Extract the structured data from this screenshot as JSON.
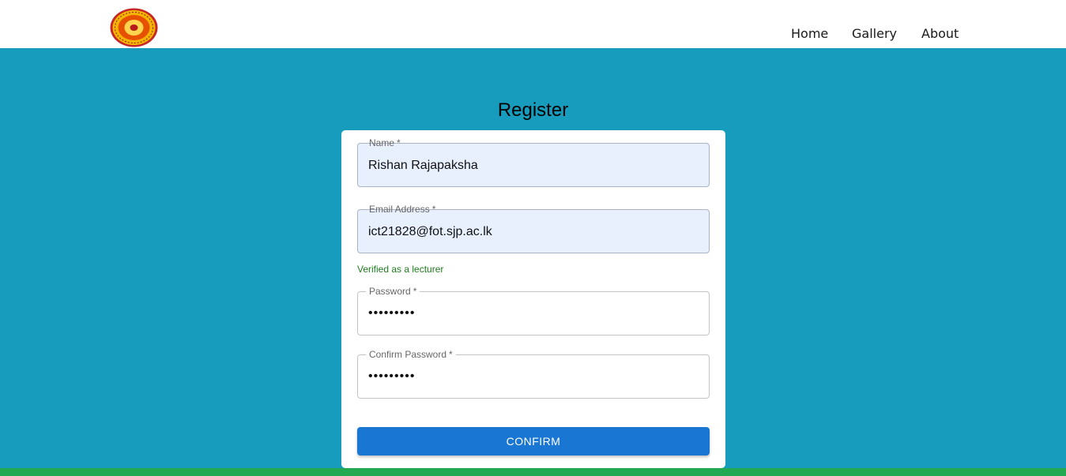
{
  "nav": {
    "items": [
      "Home",
      "Gallery",
      "About"
    ]
  },
  "page": {
    "title": "Register"
  },
  "form": {
    "name": {
      "label": "Name",
      "required": "*",
      "value": "Rishan Rajapaksha"
    },
    "email": {
      "label": "Email Address",
      "required": "*",
      "value": "ict21828@fot.sjp.ac.lk"
    },
    "email_helper": "Verified as a lecturer",
    "password": {
      "label": "Password",
      "required": "*",
      "value": "•••••••••"
    },
    "confirm_password": {
      "label": "Confirm Password",
      "required": "*",
      "value": "•••••••••"
    },
    "submit_label": "CONFIRM"
  },
  "colors": {
    "header_bg": "#ffffff",
    "page_bg": "#179cbd",
    "button": "#1976d2",
    "helper_text": "#1f7a1f",
    "bottom_strip": "#22a952"
  },
  "icons": {
    "logo": "university-seal-logo"
  }
}
